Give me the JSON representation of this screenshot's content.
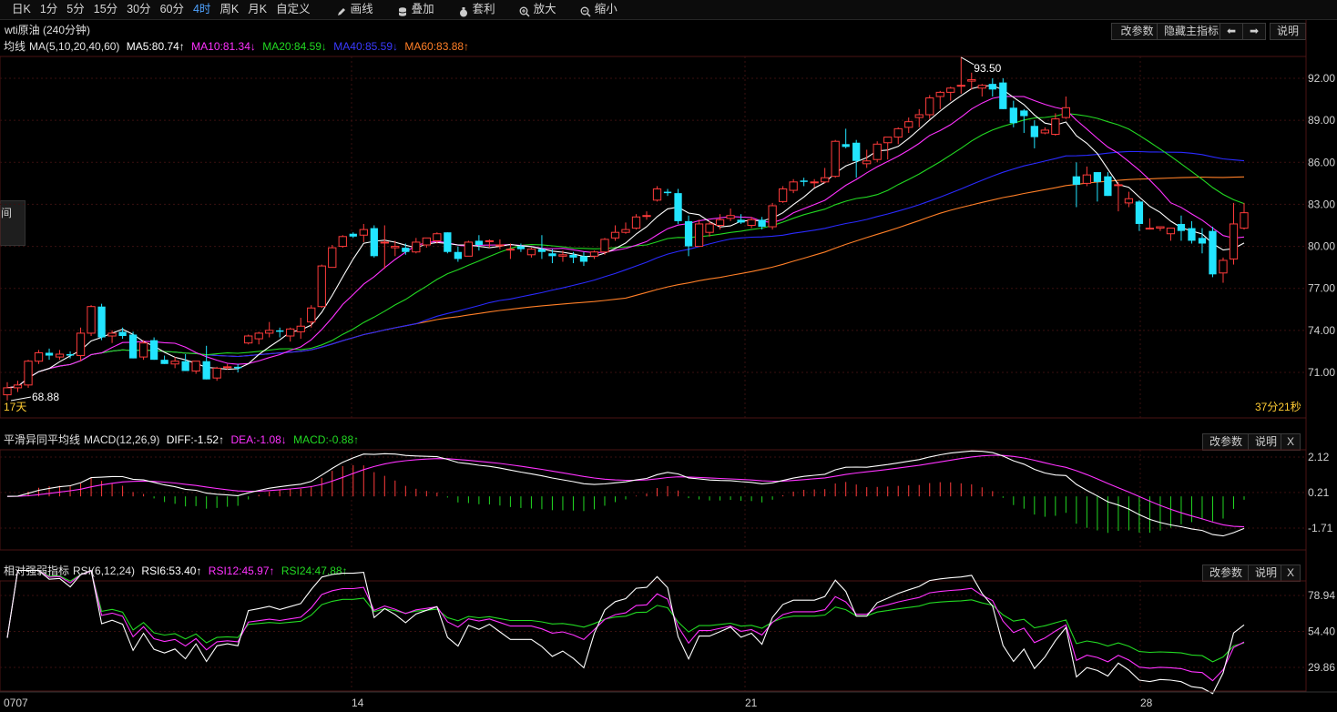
{
  "toolbar": {
    "periods": [
      "日K",
      "1分",
      "5分",
      "15分",
      "30分",
      "60分",
      "4时",
      "周K",
      "月K",
      "自定义"
    ],
    "active_period": "4时",
    "tools": [
      {
        "label": "画线",
        "icon": "pencil-icon"
      },
      {
        "label": "叠加",
        "icon": "database-icon"
      },
      {
        "label": "套利",
        "icon": "money-bag-icon"
      },
      {
        "label": "放大",
        "icon": "zoom-in-icon"
      },
      {
        "label": "缩小",
        "icon": "zoom-out-icon"
      }
    ]
  },
  "main": {
    "title": "wti原油 (240分钟)",
    "buttons": {
      "params": "改参数",
      "hide": "隐藏主指标",
      "prev": "⬅",
      "next": "➡",
      "help": "说明"
    },
    "indicator": {
      "name": "均线",
      "params": "MA(5,10,20,40,60)",
      "ma5": "MA5:80.74↑",
      "ma10": "MA10:81.34↓",
      "ma20": "MA20:84.59↓",
      "ma40": "MA40:85.59↓",
      "ma60": "MA60:83.88↑"
    },
    "high_label": "93.50",
    "low_label": "68.88",
    "days_label": "17天",
    "countdown": "37分21秒",
    "side_tab": "间",
    "y_ticks": [
      "92.00",
      "89.00",
      "86.00",
      "83.00",
      "80.00",
      "77.00",
      "74.00",
      "71.00"
    ]
  },
  "macd": {
    "name": "平滑异同平均线",
    "params": "MACD(12,26,9)",
    "diff": "DIFF:-1.52↑",
    "dea": "DEA:-1.08↓",
    "macd": "MACD:-0.88↑",
    "buttons": {
      "params": "改参数",
      "help": "说明",
      "close": "X"
    },
    "y_ticks": [
      "2.12",
      "0.21",
      "-1.71"
    ]
  },
  "rsi": {
    "name": "相对强弱指标",
    "params": "RSI(6,12,24)",
    "rsi6": "RSI6:53.40↑",
    "rsi12": "RSI12:45.97↑",
    "rsi24": "RSI24:47.88↑",
    "buttons": {
      "params": "改参数",
      "help": "说明",
      "close": "X"
    },
    "y_ticks": [
      "78.94",
      "54.40",
      "29.86"
    ]
  },
  "x_labels": [
    "0707",
    "14",
    "21",
    "28"
  ],
  "colors": {
    "up": "#ff3b3b",
    "down": "#22e4ff",
    "ma5": "#ffffff",
    "ma10": "#ff32ff",
    "ma20": "#22d922",
    "ma40": "#2a2aff",
    "ma60": "#ff7f27",
    "grid": "#3a1010",
    "ytick": "#d0d0d0",
    "countdown": "#ffcc33"
  },
  "chart_data": [
    {
      "type": "candlestick",
      "title": "wti原油 (240分钟)",
      "ohlc": [
        [
          69.4,
          70.3,
          69.0,
          69.9
        ],
        [
          69.9,
          70.4,
          69.6,
          70.1
        ],
        [
          70.1,
          71.9,
          69.9,
          71.8
        ],
        [
          71.8,
          72.6,
          71.6,
          72.4
        ],
        [
          72.4,
          72.7,
          71.9,
          72.2
        ],
        [
          72.1,
          72.6,
          71.9,
          72.3
        ],
        [
          72.3,
          72.5,
          72.0,
          72.2
        ],
        [
          72.2,
          74.2,
          71.8,
          73.8
        ],
        [
          73.8,
          75.8,
          73.6,
          75.7
        ],
        [
          75.7,
          75.9,
          73.3,
          73.5
        ],
        [
          73.6,
          74.0,
          73.1,
          73.8
        ],
        [
          73.9,
          74.2,
          73.4,
          73.6
        ],
        [
          73.7,
          73.9,
          72.0,
          72.0
        ],
        [
          72.1,
          73.3,
          71.9,
          73.1
        ],
        [
          73.3,
          73.5,
          71.9,
          71.9
        ],
        [
          71.9,
          72.2,
          71.6,
          71.6
        ],
        [
          71.6,
          72.1,
          71.3,
          71.8
        ],
        [
          71.8,
          72.3,
          71.1,
          71.1
        ],
        [
          71.1,
          71.8,
          70.9,
          71.8
        ],
        [
          71.8,
          72.9,
          70.5,
          70.5
        ],
        [
          70.6,
          71.4,
          70.4,
          71.3
        ],
        [
          71.4,
          71.6,
          71.2,
          71.4
        ],
        [
          71.4,
          71.6,
          71.0,
          71.3
        ],
        [
          73.1,
          73.7,
          73.0,
          73.6
        ],
        [
          73.4,
          73.9,
          73.0,
          73.8
        ],
        [
          73.8,
          74.6,
          73.5,
          74.0
        ],
        [
          74.0,
          74.2,
          73.5,
          73.9
        ],
        [
          73.6,
          74.2,
          73.2,
          74.1
        ],
        [
          73.9,
          74.9,
          73.4,
          74.3
        ],
        [
          74.6,
          75.8,
          74.2,
          75.6
        ],
        [
          75.7,
          78.7,
          75.6,
          78.6
        ],
        [
          78.5,
          80.1,
          78.5,
          79.9
        ],
        [
          80.0,
          80.8,
          79.9,
          80.7
        ],
        [
          80.9,
          81.0,
          80.6,
          80.7
        ],
        [
          80.8,
          81.6,
          80.3,
          81.2
        ],
        [
          81.3,
          81.5,
          79.2,
          79.3
        ],
        [
          80.3,
          81.5,
          78.4,
          80.3
        ],
        [
          79.9,
          80.4,
          79.3,
          80.0
        ],
        [
          79.9,
          80.2,
          79.4,
          79.6
        ],
        [
          79.6,
          80.6,
          79.5,
          80.3
        ],
        [
          80.1,
          80.6,
          79.9,
          80.6
        ],
        [
          80.4,
          81.0,
          80.2,
          80.9
        ],
        [
          81.0,
          81.0,
          79.5,
          79.6
        ],
        [
          79.6,
          80.0,
          78.9,
          79.1
        ],
        [
          79.3,
          80.4,
          79.3,
          80.3
        ],
        [
          80.4,
          80.8,
          79.7,
          80.1
        ],
        [
          80.4,
          80.5,
          79.9,
          80.4
        ],
        [
          80.1,
          80.5,
          79.8,
          80.1
        ],
        [
          79.8,
          80.2,
          79.1,
          79.8
        ],
        [
          80.0,
          80.2,
          79.6,
          79.8
        ],
        [
          79.4,
          79.9,
          79.2,
          79.8
        ],
        [
          79.8,
          80.8,
          79.1,
          79.6
        ],
        [
          79.5,
          79.8,
          78.8,
          79.3
        ],
        [
          79.3,
          79.7,
          78.9,
          79.4
        ],
        [
          79.4,
          79.6,
          78.8,
          79.2
        ],
        [
          79.3,
          79.6,
          78.6,
          78.9
        ],
        [
          79.3,
          79.7,
          79.1,
          79.6
        ],
        [
          79.6,
          80.6,
          79.4,
          80.5
        ],
        [
          80.6,
          81.5,
          80.4,
          81.0
        ],
        [
          81.0,
          81.7,
          80.9,
          81.2
        ],
        [
          81.3,
          82.3,
          81.2,
          82.1
        ],
        [
          82.2,
          82.5,
          81.9,
          82.2
        ],
        [
          83.3,
          84.3,
          83.2,
          84.1
        ],
        [
          83.9,
          84.1,
          83.6,
          83.8
        ],
        [
          83.8,
          84.1,
          81.6,
          81.8
        ],
        [
          81.8,
          82.2,
          79.3,
          80.0
        ],
        [
          80.0,
          81.9,
          80.0,
          81.6
        ],
        [
          81.0,
          81.8,
          80.7,
          81.6
        ],
        [
          81.5,
          82.3,
          81.2,
          81.9
        ],
        [
          82.0,
          82.7,
          81.8,
          82.2
        ],
        [
          81.9,
          82.3,
          81.6,
          81.7
        ],
        [
          81.5,
          82.1,
          81.3,
          81.9
        ],
        [
          81.9,
          82.1,
          81.2,
          81.4
        ],
        [
          81.4,
          83.1,
          81.2,
          82.9
        ],
        [
          83.2,
          84.3,
          83.1,
          84.1
        ],
        [
          84.0,
          84.8,
          83.8,
          84.6
        ],
        [
          84.7,
          84.9,
          84.3,
          84.6
        ],
        [
          84.6,
          84.8,
          84.2,
          84.6
        ],
        [
          84.6,
          85.6,
          84.5,
          84.9
        ],
        [
          85.0,
          87.6,
          84.9,
          87.5
        ],
        [
          87.3,
          88.4,
          87.0,
          87.1
        ],
        [
          87.4,
          87.6,
          84.9,
          86.1
        ],
        [
          85.9,
          86.9,
          85.6,
          86.1
        ],
        [
          86.2,
          87.5,
          86.0,
          87.3
        ],
        [
          87.4,
          87.8,
          86.2,
          87.8
        ],
        [
          87.8,
          88.5,
          87.3,
          88.4
        ],
        [
          88.5,
          89.2,
          88.1,
          88.9
        ],
        [
          89.2,
          89.8,
          88.5,
          89.4
        ],
        [
          89.4,
          90.8,
          89.1,
          90.6
        ],
        [
          90.7,
          91.1,
          89.8,
          91.0
        ],
        [
          91.0,
          91.4,
          90.4,
          91.3
        ],
        [
          91.5,
          93.5,
          90.9,
          91.5
        ],
        [
          91.8,
          92.4,
          91.2,
          91.9
        ],
        [
          91.3,
          91.6,
          90.7,
          91.5
        ],
        [
          91.6,
          92.0,
          90.7,
          91.2
        ],
        [
          91.7,
          92.0,
          89.8,
          89.8
        ],
        [
          89.9,
          90.4,
          88.5,
          88.8
        ],
        [
          89.7,
          89.8,
          88.1,
          89.3
        ],
        [
          88.6,
          89.0,
          87.0,
          87.8
        ],
        [
          88.1,
          88.5,
          88.0,
          88.3
        ],
        [
          88.0,
          89.5,
          87.9,
          89.1
        ],
        [
          89.2,
          90.7,
          89.1,
          89.9
        ],
        [
          85.0,
          86.0,
          82.8,
          84.4
        ],
        [
          84.5,
          85.7,
          84.3,
          85.1
        ],
        [
          85.3,
          85.3,
          83.2,
          84.6
        ],
        [
          85.0,
          85.3,
          83.6,
          83.6
        ],
        [
          84.4,
          84.6,
          82.5,
          84.4
        ],
        [
          83.1,
          83.9,
          82.8,
          83.4
        ],
        [
          83.2,
          83.3,
          81.1,
          81.6
        ],
        [
          81.3,
          82.0,
          81.2,
          81.3
        ],
        [
          81.3,
          81.4,
          81.1,
          81.4
        ],
        [
          80.9,
          81.2,
          80.4,
          81.3
        ],
        [
          81.6,
          82.2,
          80.4,
          81.1
        ],
        [
          81.3,
          81.8,
          80.2,
          80.4
        ],
        [
          80.6,
          81.3,
          79.5,
          80.2
        ],
        [
          81.1,
          81.4,
          77.8,
          78.0
        ],
        [
          78.1,
          79.2,
          77.4,
          79.0
        ],
        [
          79.1,
          83.1,
          78.7,
          81.6
        ],
        [
          81.3,
          83.1,
          81.2,
          82.4
        ]
      ],
      "ma5_last": 80.74,
      "ma10_last": 81.34,
      "ma20_last": 84.59,
      "ma40_last": 85.59,
      "ma60_last": 83.88,
      "high": 93.5,
      "low": 68.88
    },
    {
      "type": "line",
      "title": "MACD(12,26,9)",
      "series": [
        {
          "name": "DIFF",
          "last": -1.52
        },
        {
          "name": "DEA",
          "last": -1.08
        },
        {
          "name": "MACD",
          "last": -0.88
        }
      ]
    },
    {
      "type": "line",
      "title": "RSI(6,12,24)",
      "series": [
        {
          "name": "RSI6",
          "last": 53.4
        },
        {
          "name": "RSI12",
          "last": 45.97
        },
        {
          "name": "RSI24",
          "last": 47.88
        }
      ]
    }
  ]
}
